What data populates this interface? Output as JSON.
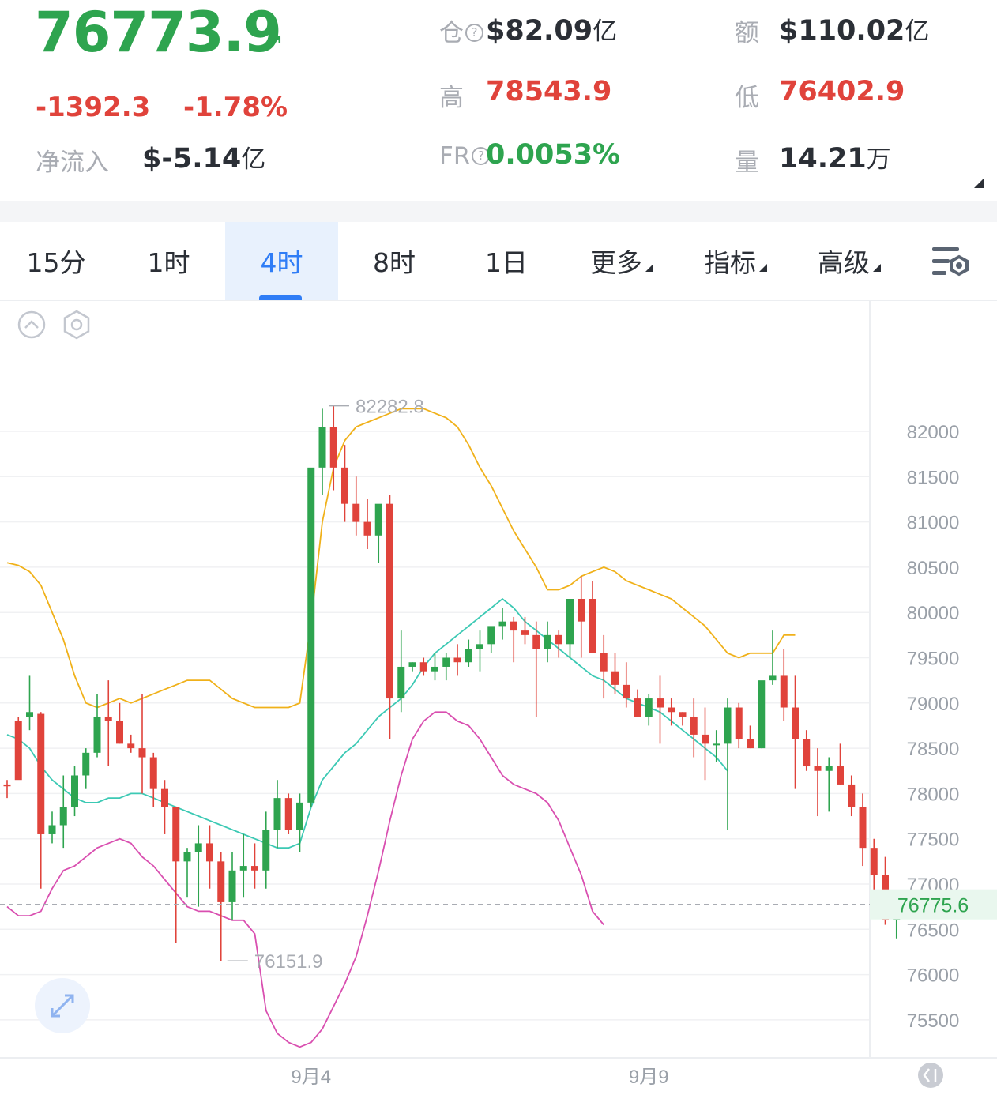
{
  "ticker": {
    "price": "76773.9",
    "change": "-1392.3",
    "change_pct": "-1.78%",
    "net_inflow_label": "净流入",
    "net_inflow_value": "$-5.14",
    "net_inflow_unit": "亿",
    "oi_label": "仓",
    "oi_value": "$82.09",
    "oi_unit": "亿",
    "turnover_label": "额",
    "turnover_value": "$110.02",
    "turnover_unit": "亿",
    "high_label": "高",
    "high_value": "78543.9",
    "low_label": "低",
    "low_value": "76402.9",
    "fr_label": "FR",
    "fr_value": "0.0053%",
    "volume_label": "量",
    "volume_value": "14.21",
    "volume_unit": "万"
  },
  "tabs": [
    {
      "label": "15分",
      "active": false
    },
    {
      "label": "1时",
      "active": false
    },
    {
      "label": "4时",
      "active": true
    },
    {
      "label": "8时",
      "active": false
    },
    {
      "label": "1日",
      "active": false
    },
    {
      "label": "更多",
      "active": false
    },
    {
      "label": "指标",
      "active": false
    },
    {
      "label": "高级",
      "active": false
    }
  ],
  "icons": {
    "collapse": "chevron-up-circle-icon",
    "settings": "hexagon-settings-icon",
    "chart_settings": "chart-settings-icon",
    "expand": "expand-arrows-icon",
    "scroll_to_latest": "jump-to-latest-icon"
  },
  "colors": {
    "up": "#2ea44f",
    "down": "#e0433b",
    "upper_band": "#f0b11a",
    "middle_band": "#3cc9b4",
    "lower_band": "#d94fb0",
    "accent": "#2f7df6"
  },
  "chart_data": {
    "type": "candlestick",
    "y_ticks": [
      82000,
      81500,
      81000,
      80500,
      80000,
      79500,
      79000,
      78500,
      78000,
      77500,
      77000,
      76500,
      76000,
      75500
    ],
    "x_labels": [
      {
        "index": 27,
        "label": "9月4"
      },
      {
        "index": 57,
        "label": "9月9"
      }
    ],
    "current_price": "76775.6",
    "current_value": 76775.6,
    "high_marker": {
      "index": 28,
      "value": 82282.8,
      "label": "82282.8"
    },
    "low_marker": {
      "index": 19,
      "value": 76151.9,
      "label": "76151.9"
    },
    "candles": [
      [
        78100,
        78150,
        77950,
        78080
      ],
      [
        78800,
        78850,
        78300,
        78150
      ],
      [
        78850,
        79300,
        78700,
        78900
      ],
      [
        78880,
        78900,
        76950,
        77550
      ],
      [
        77550,
        77800,
        77450,
        77650
      ],
      [
        77650,
        78200,
        77400,
        77850
      ],
      [
        77850,
        78300,
        77750,
        78200
      ],
      [
        78200,
        78500,
        78050,
        78450
      ],
      [
        78450,
        79100,
        78400,
        78850
      ],
      [
        78850,
        79250,
        78300,
        78800
      ],
      [
        78800,
        79000,
        78550,
        78550
      ],
      [
        78550,
        78650,
        78450,
        78500
      ],
      [
        78500,
        79100,
        78000,
        78400
      ],
      [
        78400,
        78450,
        77850,
        78050
      ],
      [
        78050,
        78150,
        77550,
        77850
      ],
      [
        77850,
        77850,
        76350,
        77250
      ],
      [
        77250,
        77400,
        76850,
        77350
      ],
      [
        77350,
        77650,
        76750,
        77450
      ],
      [
        77450,
        77650,
        76950,
        77250
      ],
      [
        77250,
        77350,
        76150,
        76800
      ],
      [
        76800,
        77350,
        76600,
        77150
      ],
      [
        77150,
        77550,
        76850,
        77200
      ],
      [
        77200,
        77450,
        76950,
        77150
      ],
      [
        77150,
        77800,
        76950,
        77600
      ],
      [
        77600,
        78150,
        77400,
        77950
      ],
      [
        77950,
        78000,
        77550,
        77600
      ],
      [
        77600,
        78000,
        77350,
        77900
      ],
      [
        77900,
        80000,
        77850,
        81600
      ],
      [
        81600,
        82250,
        81300,
        82050
      ],
      [
        82050,
        82280,
        81350,
        81600
      ],
      [
        81600,
        81850,
        81000,
        81200
      ],
      [
        81200,
        81500,
        80850,
        81000
      ],
      [
        81000,
        81250,
        80700,
        80850
      ],
      [
        80850,
        81150,
        80550,
        81200
      ],
      [
        81200,
        81300,
        78600,
        79050
      ],
      [
        79050,
        79800,
        78900,
        79400
      ],
      [
        79400,
        79450,
        79350,
        79450
      ],
      [
        79450,
        79500,
        79300,
        79350
      ],
      [
        79350,
        79550,
        79250,
        79400
      ],
      [
        79400,
        79550,
        79250,
        79500
      ],
      [
        79500,
        79650,
        79300,
        79450
      ],
      [
        79450,
        79700,
        79400,
        79600
      ],
      [
        79600,
        79800,
        79350,
        79650
      ],
      [
        79650,
        79750,
        79550,
        79850
      ],
      [
        79850,
        80050,
        79700,
        79900
      ],
      [
        79900,
        79950,
        79450,
        79800
      ],
      [
        79800,
        79950,
        79650,
        79750
      ],
      [
        79750,
        79900,
        78850,
        79600
      ],
      [
        79600,
        79900,
        79450,
        79750
      ],
      [
        79750,
        79800,
        79500,
        79650
      ],
      [
        79650,
        80050,
        79500,
        80150
      ],
      [
        80150,
        80400,
        79500,
        79900
      ],
      [
        80150,
        80350,
        79550,
        79550
      ],
      [
        79550,
        79750,
        79050,
        79350
      ],
      [
        79350,
        79550,
        79100,
        79200
      ],
      [
        79200,
        79450,
        78950,
        79050
      ],
      [
        79050,
        79150,
        78850,
        78850
      ],
      [
        78850,
        79100,
        78750,
        79050
      ],
      [
        79050,
        79300,
        78550,
        78950
      ],
      [
        78950,
        79050,
        78750,
        78900
      ],
      [
        78900,
        78900,
        78750,
        78850
      ],
      [
        78850,
        79050,
        78400,
        78650
      ],
      [
        78650,
        78950,
        78150,
        78550
      ],
      [
        78550,
        78700,
        78350,
        78550
      ],
      [
        78550,
        79050,
        77600,
        78950
      ],
      [
        78950,
        79000,
        78500,
        78600
      ],
      [
        78600,
        78750,
        78500,
        78500
      ],
      [
        78500,
        79200,
        78500,
        79250
      ],
      [
        79250,
        79800,
        79200,
        79300
      ],
      [
        79300,
        79600,
        78800,
        78950
      ],
      [
        78950,
        79300,
        78050,
        78600
      ],
      [
        78600,
        78700,
        78250,
        78300
      ],
      [
        78300,
        78500,
        77750,
        78250
      ],
      [
        78250,
        78400,
        77800,
        78300
      ],
      [
        78300,
        78550,
        78100,
        78100
      ],
      [
        78100,
        78200,
        77750,
        77850
      ],
      [
        77850,
        78000,
        77200,
        77400
      ],
      [
        77400,
        77500,
        76700,
        77100
      ],
      [
        77100,
        77300,
        76550,
        76600
      ],
      [
        76600,
        76800,
        76400,
        76750
      ]
    ],
    "bollinger": {
      "upper": [
        [
          0,
          80550
        ],
        [
          1,
          80520
        ],
        [
          2,
          80450
        ],
        [
          3,
          80300
        ],
        [
          4,
          80000
        ],
        [
          5,
          79700
        ],
        [
          6,
          79300
        ],
        [
          7,
          79000
        ],
        [
          8,
          78950
        ],
        [
          9,
          79000
        ],
        [
          10,
          79050
        ],
        [
          11,
          79000
        ],
        [
          12,
          79050
        ],
        [
          13,
          79100
        ],
        [
          14,
          79150
        ],
        [
          15,
          79200
        ],
        [
          16,
          79250
        ],
        [
          17,
          79250
        ],
        [
          18,
          79250
        ],
        [
          19,
          79150
        ],
        [
          20,
          79050
        ],
        [
          21,
          79000
        ],
        [
          22,
          78950
        ],
        [
          23,
          78950
        ],
        [
          24,
          78950
        ],
        [
          25,
          78950
        ],
        [
          26,
          79000
        ],
        [
          27,
          79900
        ],
        [
          28,
          81000
        ],
        [
          29,
          81600
        ],
        [
          30,
          81900
        ],
        [
          31,
          82050
        ],
        [
          32,
          82100
        ],
        [
          33,
          82150
        ],
        [
          34,
          82200
        ],
        [
          35,
          82250
        ],
        [
          36,
          82250
        ],
        [
          37,
          82250
        ],
        [
          38,
          82200
        ],
        [
          39,
          82150
        ],
        [
          40,
          82050
        ],
        [
          41,
          81850
        ],
        [
          42,
          81600
        ],
        [
          43,
          81400
        ],
        [
          44,
          81150
        ],
        [
          45,
          80900
        ],
        [
          46,
          80700
        ],
        [
          47,
          80500
        ],
        [
          48,
          80250
        ],
        [
          49,
          80250
        ],
        [
          50,
          80300
        ],
        [
          51,
          80400
        ],
        [
          52,
          80450
        ],
        [
          53,
          80500
        ],
        [
          54,
          80450
        ],
        [
          55,
          80350
        ],
        [
          56,
          80300
        ],
        [
          57,
          80250
        ],
        [
          58,
          80200
        ],
        [
          59,
          80150
        ],
        [
          60,
          80050
        ],
        [
          61,
          79950
        ],
        [
          62,
          79850
        ],
        [
          63,
          79700
        ],
        [
          64,
          79550
        ],
        [
          65,
          79500
        ],
        [
          66,
          79550
        ],
        [
          67,
          79550
        ],
        [
          68,
          79550
        ],
        [
          69,
          79750
        ],
        [
          70,
          79750
        ]
      ],
      "middle": [
        [
          0,
          78650
        ],
        [
          1,
          78600
        ],
        [
          2,
          78500
        ],
        [
          3,
          78300
        ],
        [
          4,
          78150
        ],
        [
          5,
          78050
        ],
        [
          6,
          77950
        ],
        [
          7,
          77900
        ],
        [
          8,
          77900
        ],
        [
          9,
          77950
        ],
        [
          10,
          77950
        ],
        [
          11,
          78000
        ],
        [
          12,
          78000
        ],
        [
          13,
          77950
        ],
        [
          14,
          77900
        ],
        [
          15,
          77850
        ],
        [
          16,
          77800
        ],
        [
          17,
          77750
        ],
        [
          18,
          77700
        ],
        [
          19,
          77650
        ],
        [
          20,
          77600
        ],
        [
          21,
          77550
        ],
        [
          22,
          77500
        ],
        [
          23,
          77450
        ],
        [
          24,
          77400
        ],
        [
          25,
          77400
        ],
        [
          26,
          77450
        ],
        [
          27,
          77850
        ],
        [
          28,
          78150
        ],
        [
          29,
          78300
        ],
        [
          30,
          78450
        ],
        [
          31,
          78550
        ],
        [
          32,
          78700
        ],
        [
          33,
          78850
        ],
        [
          34,
          78950
        ],
        [
          35,
          79050
        ],
        [
          36,
          79200
        ],
        [
          37,
          79400
        ],
        [
          38,
          79550
        ],
        [
          39,
          79650
        ],
        [
          40,
          79750
        ],
        [
          41,
          79850
        ],
        [
          42,
          79950
        ],
        [
          43,
          80050
        ],
        [
          44,
          80150
        ],
        [
          45,
          80050
        ],
        [
          46,
          79900
        ],
        [
          47,
          79800
        ],
        [
          48,
          79700
        ],
        [
          49,
          79600
        ],
        [
          50,
          79500
        ],
        [
          51,
          79400
        ],
        [
          52,
          79300
        ],
        [
          53,
          79250
        ],
        [
          54,
          79150
        ],
        [
          55,
          79050
        ],
        [
          56,
          79000
        ],
        [
          57,
          78950
        ],
        [
          58,
          78900
        ],
        [
          59,
          78800
        ],
        [
          60,
          78700
        ],
        [
          61,
          78600
        ],
        [
          62,
          78500
        ],
        [
          63,
          78400
        ],
        [
          64,
          78250
        ]
      ],
      "lower": [
        [
          0,
          76750
        ],
        [
          1,
          76650
        ],
        [
          2,
          76650
        ],
        [
          3,
          76700
        ],
        [
          4,
          76950
        ],
        [
          5,
          77150
        ],
        [
          6,
          77200
        ],
        [
          7,
          77300
        ],
        [
          8,
          77400
        ],
        [
          9,
          77450
        ],
        [
          10,
          77500
        ],
        [
          11,
          77450
        ],
        [
          12,
          77300
        ],
        [
          13,
          77200
        ],
        [
          14,
          77050
        ],
        [
          15,
          76900
        ],
        [
          16,
          76750
        ],
        [
          17,
          76700
        ],
        [
          18,
          76700
        ],
        [
          19,
          76650
        ],
        [
          20,
          76600
        ],
        [
          21,
          76600
        ],
        [
          22,
          76450
        ],
        [
          23,
          75600
        ],
        [
          24,
          75350
        ],
        [
          25,
          75250
        ],
        [
          26,
          75200
        ],
        [
          27,
          75250
        ],
        [
          28,
          75400
        ],
        [
          29,
          75650
        ],
        [
          30,
          75900
        ],
        [
          31,
          76200
        ],
        [
          32,
          76650
        ],
        [
          33,
          77150
        ],
        [
          34,
          77700
        ],
        [
          35,
          78200
        ],
        [
          36,
          78600
        ],
        [
          37,
          78800
        ],
        [
          38,
          78900
        ],
        [
          39,
          78900
        ],
        [
          40,
          78800
        ],
        [
          41,
          78750
        ],
        [
          42,
          78600
        ],
        [
          43,
          78400
        ],
        [
          44,
          78200
        ],
        [
          45,
          78100
        ],
        [
          46,
          78050
        ],
        [
          47,
          78000
        ],
        [
          48,
          77900
        ],
        [
          49,
          77700
        ],
        [
          50,
          77400
        ],
        [
          51,
          77100
        ],
        [
          52,
          76700
        ],
        [
          53,
          76550
        ]
      ]
    }
  }
}
